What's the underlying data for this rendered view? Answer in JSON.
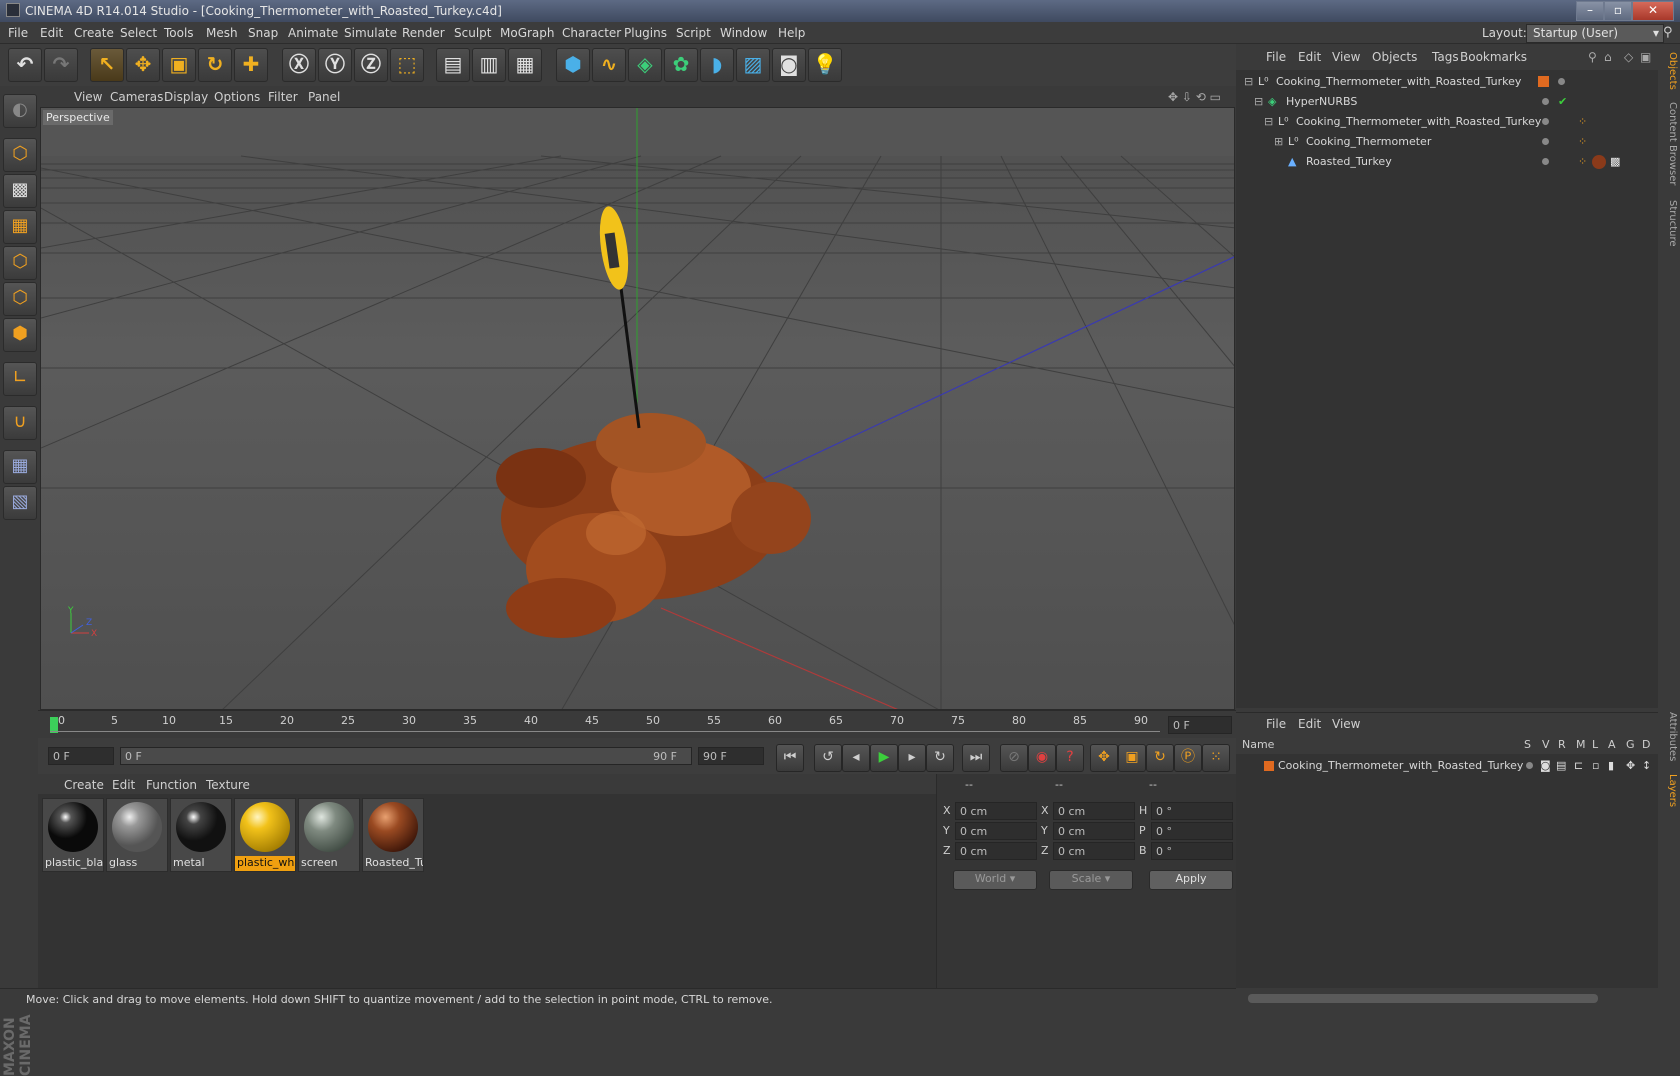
{
  "window": {
    "title": "CINEMA 4D R14.014 Studio - [Cooking_Thermometer_with_Roasted_Turkey.c4d]"
  },
  "menubar": {
    "items": [
      "File",
      "Edit",
      "Create",
      "Select",
      "Tools",
      "Mesh",
      "Snap",
      "Animate",
      "Simulate",
      "Render",
      "Sculpt",
      "MoGraph",
      "Character",
      "Plugins",
      "Script",
      "Window",
      "Help"
    ],
    "layout_label": "Layout:",
    "layout_value": "Startup (User)"
  },
  "viewport": {
    "menu": [
      "View",
      "Cameras",
      "Display",
      "Options",
      "Filter",
      "Panel"
    ],
    "label": "Perspective",
    "axis": {
      "x": "X",
      "y": "Y",
      "z": "Z"
    }
  },
  "timeline": {
    "ticks": [
      "0",
      "5",
      "10",
      "15",
      "20",
      "25",
      "30",
      "35",
      "40",
      "45",
      "50",
      "55",
      "60",
      "65",
      "70",
      "75",
      "80",
      "85",
      "90"
    ],
    "end_field": "0 F",
    "current_frame": "0 F",
    "range_start": "0 F",
    "range_end": "90 F",
    "max_field": "90 F"
  },
  "materials": {
    "menu": [
      "Create",
      "Edit",
      "Function",
      "Texture"
    ],
    "items": [
      {
        "name": "plastic_bla",
        "color": "#0a0a0a"
      },
      {
        "name": "glass",
        "color": "#7a7a7a"
      },
      {
        "name": "metal",
        "color": "#1a1a1a"
      },
      {
        "name": "plastic_whi",
        "color": "#f2c21a",
        "selected": true
      },
      {
        "name": "screen",
        "color": "#6f7a72"
      },
      {
        "name": "Roasted_Tu",
        "color": "#8a3a1a"
      }
    ]
  },
  "coordinates": {
    "headers": [
      "--",
      "--",
      "--"
    ],
    "rows": [
      {
        "a": "X",
        "av": "0 cm",
        "b": "X",
        "bv": "0 cm",
        "c": "H",
        "cv": "0 °"
      },
      {
        "a": "Y",
        "av": "0 cm",
        "b": "Y",
        "bv": "0 cm",
        "c": "P",
        "cv": "0 °"
      },
      {
        "a": "Z",
        "av": "0 cm",
        "b": "Z",
        "bv": "0 cm",
        "c": "B",
        "cv": "0 °"
      }
    ],
    "world": "World",
    "scale": "Scale",
    "apply": "Apply"
  },
  "object_manager": {
    "menu": [
      "File",
      "Edit",
      "View",
      "Objects",
      "Tags",
      "Bookmarks"
    ],
    "objects": [
      {
        "name": "Cooking_Thermometer_with_Roasted_Turkey"
      },
      {
        "name": "HyperNURBS"
      },
      {
        "name": "Cooking_Thermometer_with_Roasted_Turkey"
      },
      {
        "name": "Cooking_Thermometer"
      },
      {
        "name": "Roasted_Turkey"
      }
    ]
  },
  "layer_manager": {
    "menu": [
      "File",
      "Edit",
      "View"
    ],
    "columns": {
      "name": "Name",
      "flags": [
        "S",
        "V",
        "R",
        "M",
        "L",
        "A",
        "G",
        "D"
      ]
    },
    "layers": [
      {
        "name": "Cooking_Thermometer_with_Roasted_Turkey",
        "color": "#e06a20"
      }
    ]
  },
  "side_tabs": [
    "Objects",
    "Content Browser",
    "Structure",
    "Attributes",
    "Layers"
  ],
  "status": "Move: Click and drag to move elements. Hold down SHIFT to quantize movement / add to the selection in point mode, CTRL to remove.",
  "brand": "MAXON CINEMA 4D"
}
